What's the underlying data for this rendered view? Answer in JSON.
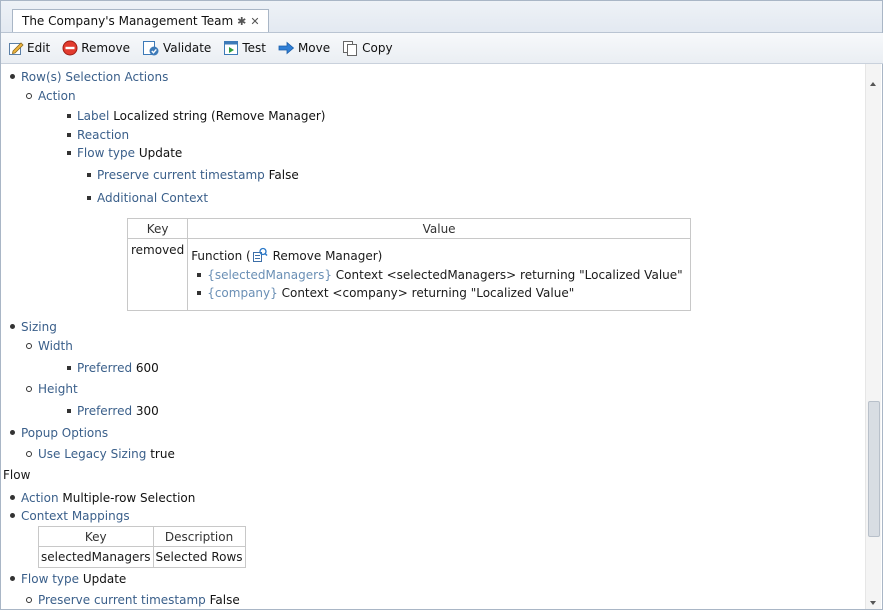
{
  "tab": {
    "title": "The Company's Management Team",
    "pin": "✱",
    "close": "✕"
  },
  "toolbar": {
    "edit": "Edit",
    "remove": "Remove",
    "validate": "Validate",
    "test": "Test",
    "move": "Move",
    "copy": "Copy"
  },
  "content": {
    "row_selection_actions": "Row(s) Selection Actions",
    "action": "Action",
    "label_label": "Label",
    "label_value": "Localized string (Remove Manager)",
    "reaction": "Reaction",
    "flow_type_label": "Flow type",
    "flow_type_value": "Update",
    "preserve_label": "Preserve current timestamp",
    "preserve_value": "False",
    "additional_context": "Additional Context",
    "context_table": {
      "header_key": "Key",
      "header_value": "Value",
      "key": "removed",
      "function_prefix": "Function (",
      "function_name": "Remove Manager)",
      "items": [
        {
          "ctx": "{selectedManagers}",
          "text": "Context <selectedManagers> returning \"Localized Value\""
        },
        {
          "ctx": "{company}",
          "text": "Context <company> returning \"Localized Value\""
        }
      ]
    },
    "sizing": "Sizing",
    "width": "Width",
    "preferred_label": "Preferred",
    "width_preferred": "600",
    "height": "Height",
    "height_preferred": "300",
    "popup_options": "Popup Options",
    "use_legacy_label": "Use Legacy Sizing",
    "use_legacy_value": "true",
    "flow": "Flow",
    "flow_action_label": "Action",
    "flow_action_value": "Multiple-row Selection",
    "context_mappings": "Context Mappings",
    "mapping_table": {
      "header_key": "Key",
      "header_description": "Description",
      "rows": [
        {
          "key": "selectedManagers",
          "description": "Selected Rows"
        }
      ]
    },
    "flow_type_label2": "Flow type",
    "flow_type_value2": "Update",
    "preserve_label2": "Preserve current timestamp",
    "preserve_value2": "False"
  }
}
